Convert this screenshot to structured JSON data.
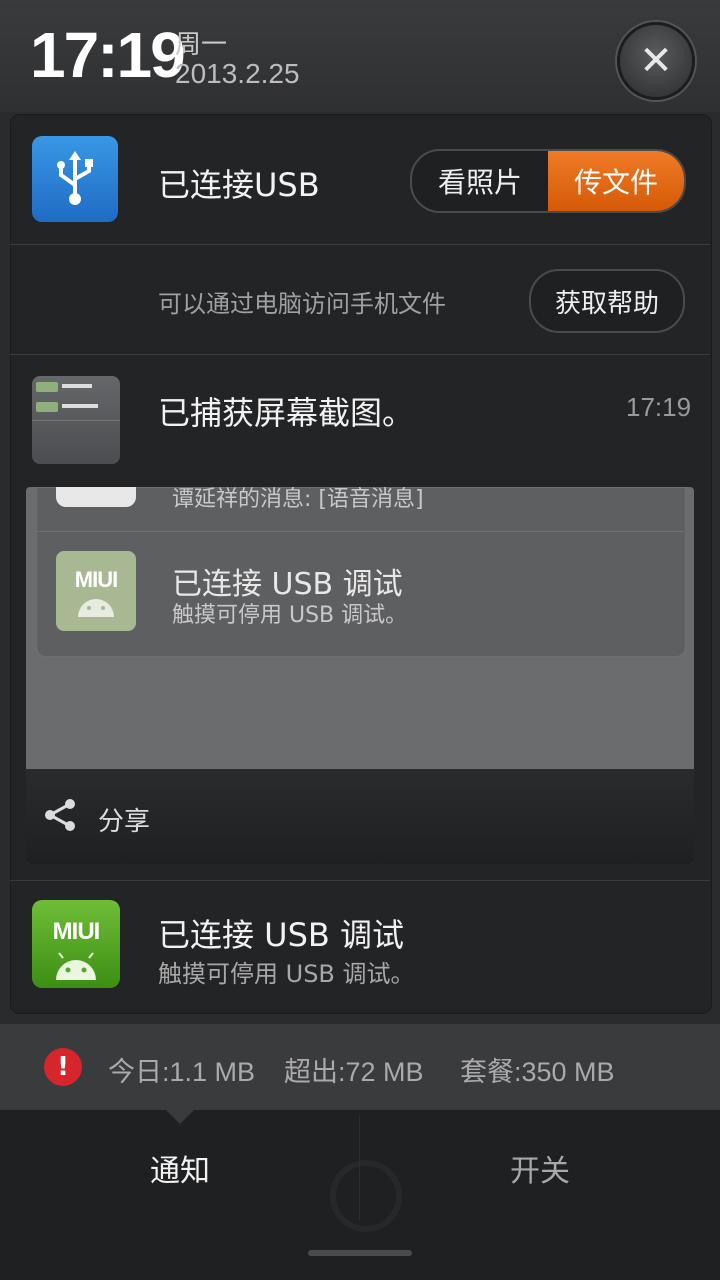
{
  "status": {
    "time": "17:19",
    "weekday": "周一",
    "date": "2013.2.25"
  },
  "usb": {
    "title": "已连接USB",
    "view_photos": "看照片",
    "transfer_files": "传文件",
    "subtitle": "可以通过电脑访问手机文件",
    "help": "获取帮助"
  },
  "screenshot_notification": {
    "title": "已捕获屏幕截图。",
    "time": "17:19",
    "preview": {
      "sms_text": "谭延祥的消息: [语音消息]",
      "miui_label": "MIUI",
      "title": "已连接 USB 调试",
      "subtitle": "触摸可停用 USB 调试。"
    },
    "share_label": "分享"
  },
  "usb_debug": {
    "icon_label": "MIUI",
    "title": "已连接 USB 调试",
    "subtitle": "触摸可停用 USB 调试。"
  },
  "data_usage": {
    "today": "今日:1.1 MB",
    "exceeded": "超出:72 MB",
    "plan": "套餐:350 MB",
    "alert_color": "#d7262b"
  },
  "tabs": {
    "notifications": "通知",
    "toggles": "开关"
  },
  "colors": {
    "accent_orange": "#e86a16",
    "usb_blue": "#2a80d6",
    "miui_green": "#55a826"
  }
}
